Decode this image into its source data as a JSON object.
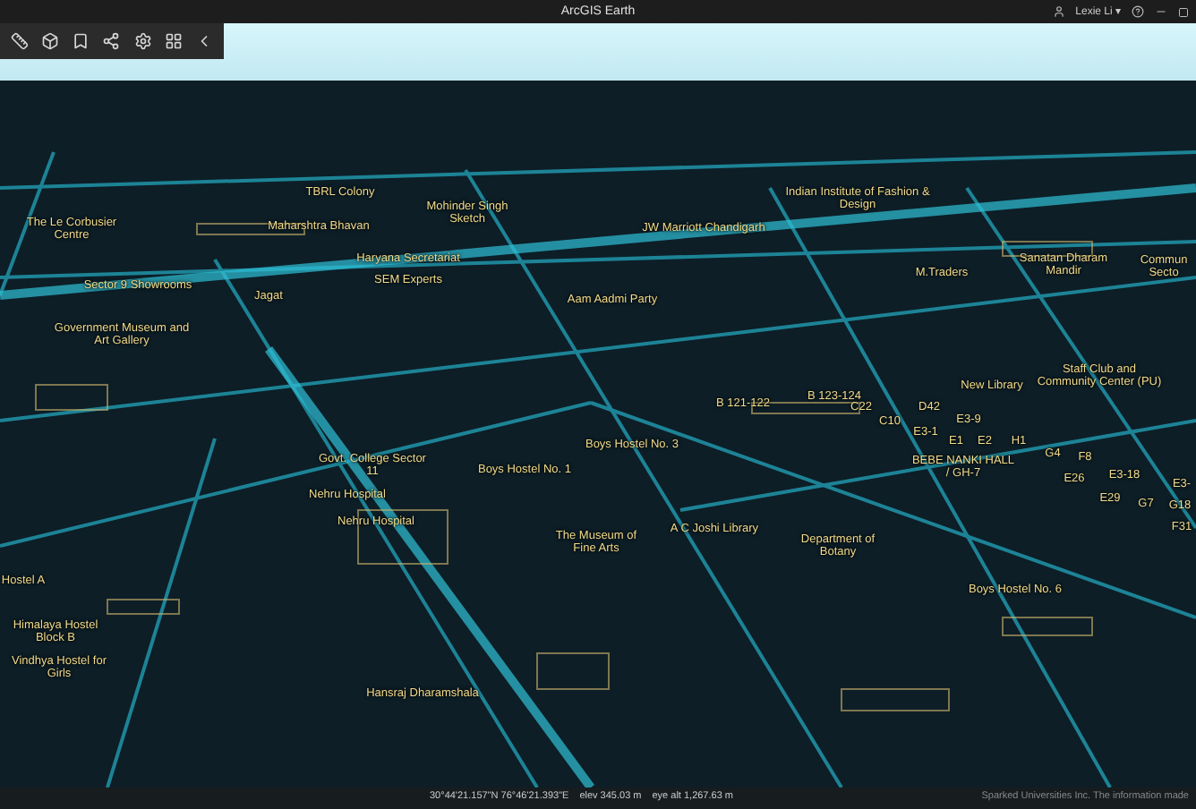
{
  "window": {
    "title": "ArcGIS Earth"
  },
  "user": {
    "name": "Lexie Li ▾"
  },
  "map": {
    "labels": [
      {
        "text": "TBRL Colony"
      },
      {
        "text": "Mohinder Singh Sketch"
      },
      {
        "text": "The Le Corbusier Centre"
      },
      {
        "text": "Maharshtra Bhavan"
      },
      {
        "text": "JW Marriott Chandigarh"
      },
      {
        "text": "Indian Institute of Fashion & Design"
      },
      {
        "text": "Haryana Secretariat"
      },
      {
        "text": "SEM Experts"
      },
      {
        "text": "M.Traders"
      },
      {
        "text": "Sanatan Dharam Mandir"
      },
      {
        "text": "Commun Secto"
      },
      {
        "text": "Sector 9 Showrooms"
      },
      {
        "text": "Jagat"
      },
      {
        "text": "Aam Aadmi Party"
      },
      {
        "text": "Government Museum and Art Gallery"
      },
      {
        "text": "B 121-122"
      },
      {
        "text": "B 123-124"
      },
      {
        "text": "New Library"
      },
      {
        "text": "Staff Club and Community Center (PU)"
      },
      {
        "text": "C22"
      },
      {
        "text": "D42"
      },
      {
        "text": "C10"
      },
      {
        "text": "E3-9"
      },
      {
        "text": "E3-1"
      },
      {
        "text": "E1"
      },
      {
        "text": "E2"
      },
      {
        "text": "H1"
      },
      {
        "text": "BEBE NANKI HALL / GH-7"
      },
      {
        "text": "G4"
      },
      {
        "text": "F8"
      },
      {
        "text": "E26"
      },
      {
        "text": "E3-18"
      },
      {
        "text": "E29"
      },
      {
        "text": "G7"
      },
      {
        "text": "E3-"
      },
      {
        "text": "G18"
      },
      {
        "text": "F31"
      },
      {
        "text": "Boys Hostel No. 3"
      },
      {
        "text": "Govt. College Sector 11"
      },
      {
        "text": "Boys Hostel No. 1"
      },
      {
        "text": "Nehru Hospital"
      },
      {
        "text": "Nehru Hospital"
      },
      {
        "text": "The Museum of Fine Arts"
      },
      {
        "text": "A C Joshi Library"
      },
      {
        "text": "Department of Botany"
      },
      {
        "text": "Boys Hostel No. 6"
      },
      {
        "text": "Hostel A"
      },
      {
        "text": "Himalaya Hostel Block B"
      },
      {
        "text": "Vindhya Hostel for Girls"
      },
      {
        "text": "Hansraj Dharamshala"
      }
    ]
  },
  "status_bar": {
    "coordinates": "30°44'21.157\"N 76°46'21.393\"E",
    "elevation": "elev 345.03 m",
    "eye_altitude": "eye alt 1,267.63 m",
    "attribution": "Sparked Universities Inc. The information made"
  }
}
